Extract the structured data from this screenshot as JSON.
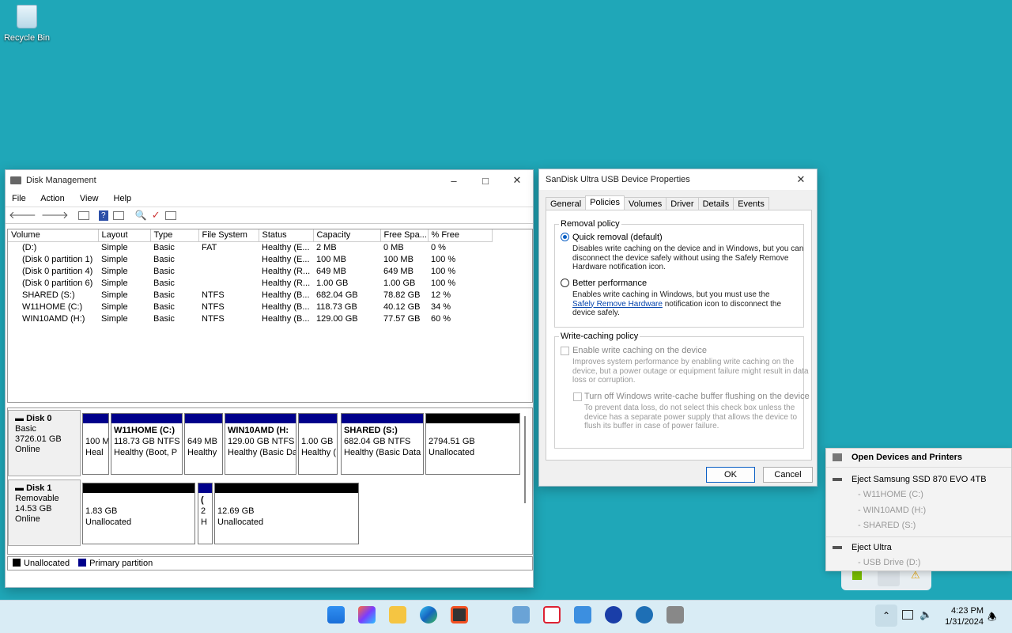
{
  "desktop": {
    "recycle_bin_label": "Recycle Bin"
  },
  "disk_mgmt": {
    "title": "Disk Management",
    "menu": [
      "File",
      "Action",
      "View",
      "Help"
    ],
    "columns": [
      "Volume",
      "Layout",
      "Type",
      "File System",
      "Status",
      "Capacity",
      "Free Spa...",
      "% Free"
    ],
    "rows": [
      [
        "(D:)",
        "Simple",
        "Basic",
        "FAT",
        "Healthy (E...",
        "2 MB",
        "0 MB",
        "0 %"
      ],
      [
        "(Disk 0 partition 1)",
        "Simple",
        "Basic",
        "",
        "Healthy (E...",
        "100 MB",
        "100 MB",
        "100 %"
      ],
      [
        "(Disk 0 partition 4)",
        "Simple",
        "Basic",
        "",
        "Healthy (R...",
        "649 MB",
        "649 MB",
        "100 %"
      ],
      [
        "(Disk 0 partition 6)",
        "Simple",
        "Basic",
        "",
        "Healthy (R...",
        "1.00 GB",
        "1.00 GB",
        "100 %"
      ],
      [
        "SHARED (S:)",
        "Simple",
        "Basic",
        "NTFS",
        "Healthy (B...",
        "682.04 GB",
        "78.82 GB",
        "12 %"
      ],
      [
        "W11HOME (C:)",
        "Simple",
        "Basic",
        "NTFS",
        "Healthy (B...",
        "118.73 GB",
        "40.12 GB",
        "34 %"
      ],
      [
        "WIN10AMD (H:)",
        "Simple",
        "Basic",
        "NTFS",
        "Healthy (B...",
        "129.00 GB",
        "77.57 GB",
        "60 %"
      ]
    ],
    "disk0": {
      "name": "Disk 0",
      "type": "Basic",
      "size": "3726.01 GB",
      "state": "Online",
      "parts": [
        {
          "l1": "",
          "l2": "100 M",
          "l3": "Heal"
        },
        {
          "l1": "W11HOME  (C:)",
          "l2": "118.73 GB NTFS",
          "l3": "Healthy (Boot, P"
        },
        {
          "l1": "",
          "l2": "649 MB",
          "l3": "Healthy"
        },
        {
          "l1": "WIN10AMD  (H:",
          "l2": "129.00 GB NTFS",
          "l3": "Healthy (Basic Da"
        },
        {
          "l1": "",
          "l2": "1.00 GB",
          "l3": "Healthy ("
        },
        {
          "l1": "SHARED  (S:)",
          "l2": "682.04 GB NTFS",
          "l3": "Healthy (Basic Data"
        },
        {
          "l1": "",
          "l2": "2794.51 GB",
          "l3": "Unallocated"
        }
      ]
    },
    "disk1": {
      "name": "Disk 1",
      "type": "Removable",
      "size": "14.53 GB",
      "state": "Online",
      "parts": [
        {
          "l1": "",
          "l2": "1.83 GB",
          "l3": "Unallocated"
        },
        {
          "l1": "(",
          "l2": "2",
          "l3": "H"
        },
        {
          "l1": "",
          "l2": "12.69 GB",
          "l3": "Unallocated"
        }
      ]
    },
    "legend": {
      "unallocated": "Unallocated",
      "primary": "Primary partition"
    }
  },
  "props": {
    "title": "SanDisk Ultra USB Device Properties",
    "tabs": [
      "General",
      "Policies",
      "Volumes",
      "Driver",
      "Details",
      "Events"
    ],
    "removal_title": "Removal policy",
    "quick_label": "Quick removal (default)",
    "quick_desc": [
      "Disables write caching on the device and in Windows, but you can",
      "disconnect the device safely without using the Safely Remove",
      "Hardware notification icon."
    ],
    "better_label": "Better performance",
    "better_desc1": "Enables write caching in Windows, but you must use the",
    "better_link": "Safely Remove Hardware",
    "better_desc2": " notification icon to disconnect the",
    "better_desc3": "device safely.",
    "wc_title": "Write-caching policy",
    "enable_label": "Enable write caching on the device",
    "enable_desc": [
      "Improves system performance by enabling write caching on the",
      "device, but a power outage or equipment failure might result in data",
      "loss or corruption."
    ],
    "flush_label": "Turn off Windows write-cache buffer flushing on the device",
    "flush_desc": [
      "To prevent data loss, do not select this check box unless the",
      "device has a separate power supply that allows the device to",
      "flush its buffer in case of power failure."
    ],
    "ok": "OK",
    "cancel": "Cancel"
  },
  "tray_menu": {
    "open": "Open Devices and Printers",
    "eject1": "Eject Samsung SSD 870 EVO 4TB",
    "vol1": "- W11HOME (C:)",
    "vol2": "- WIN10AMD (H:)",
    "vol3": "- SHARED (S:)",
    "eject2": "Eject Ultra",
    "vol4": "- USB Drive (D:)"
  },
  "taskbar": {
    "time": "4:23 PM",
    "date": "1/31/2024"
  }
}
